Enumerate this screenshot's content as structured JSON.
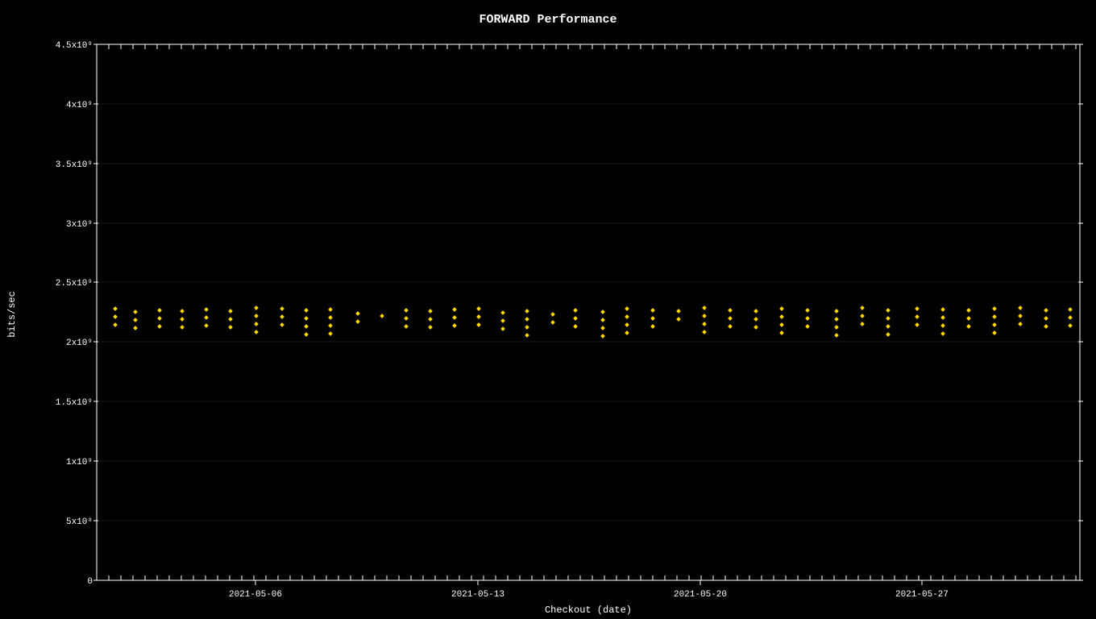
{
  "chart": {
    "title": "FORWARD Performance",
    "x_axis_label": "Checkout (date)",
    "y_axis_label": "bits/sec",
    "y_ticks": [
      {
        "label": "0",
        "value": 0
      },
      {
        "label": "5x10⁸",
        "value": 500000000
      },
      {
        "label": "1x10⁹",
        "value": 1000000000
      },
      {
        "label": "1.5x10⁹",
        "value": 1500000000
      },
      {
        "label": "2x10⁹",
        "value": 2000000000
      },
      {
        "label": "2.5x10⁹",
        "value": 2500000000
      },
      {
        "label": "3x10⁹",
        "value": 3000000000
      },
      {
        "label": "3.5x10⁹",
        "value": 3500000000
      },
      {
        "label": "4x10⁹",
        "value": 4000000000
      },
      {
        "label": "4.5x10⁹",
        "value": 4500000000
      }
    ],
    "x_ticks": [
      {
        "label": "2021-05-06"
      },
      {
        "label": "2021-05-13"
      },
      {
        "label": "2021-05-20"
      },
      {
        "label": "2021-05-27"
      }
    ],
    "dot_color": "#FFD700",
    "grid_color": "#333"
  }
}
